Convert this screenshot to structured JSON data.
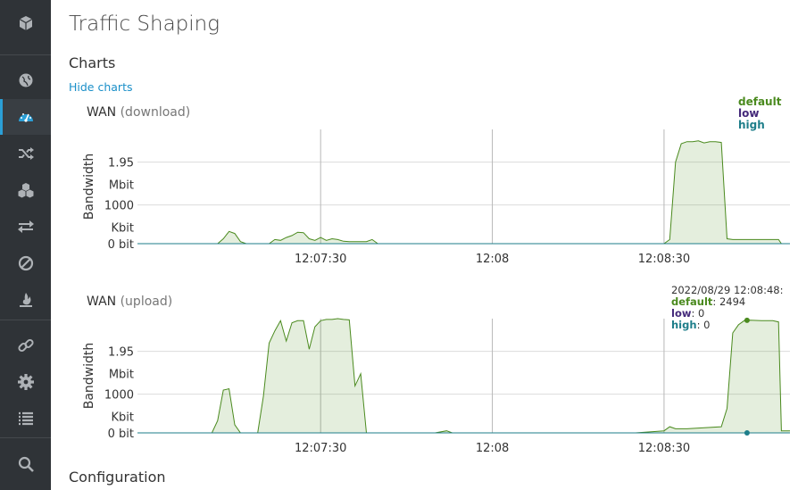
{
  "page": {
    "title": "Traffic Shaping"
  },
  "sections": {
    "charts": "Charts",
    "hide_charts": "Hide charts",
    "configuration": "Configuration"
  },
  "sidebar": {
    "items": [
      {
        "icon": "cube-icon"
      },
      {
        "icon": "globe-icon"
      },
      {
        "icon": "dashboard-icon",
        "active": true
      },
      {
        "icon": "shuffle-icon"
      },
      {
        "icon": "cubes-icon"
      },
      {
        "icon": "exchange-icon"
      },
      {
        "icon": "ban-icon"
      },
      {
        "icon": "fire-icon"
      },
      {
        "icon": "link-icon"
      },
      {
        "icon": "gear-icon"
      },
      {
        "icon": "list-icon"
      },
      {
        "icon": "search-icon"
      }
    ]
  },
  "colors": {
    "default": "#4a8a1e",
    "low": "#44297a",
    "high": "#1e7e8a",
    "link": "#1a8fc8"
  },
  "legend": {
    "default": "default",
    "low": "low",
    "high": "high"
  },
  "tooltip": {
    "time": "2022/08/29 12:08:48:",
    "default_label": "default",
    "default_value": ": 2494",
    "low_label": "low",
    "low_value": ": 0",
    "high_label": "high",
    "high_value": ": 0"
  },
  "chart_data": [
    {
      "type": "area",
      "title": "WAN",
      "subtitle": "(download)",
      "ylabel": "Bandwidth",
      "yticks": [
        {
          "label": "1.95",
          "value": 2.0
        },
        {
          "label": "Mbit",
          "value": 1.45
        },
        {
          "label": "1000",
          "value": 0.95
        },
        {
          "label": "Kbit",
          "value": 0.4
        },
        {
          "label": "0 bit",
          "value": 0
        }
      ],
      "ylim": [
        0,
        2.8
      ],
      "xlim": [
        -62,
        52
      ],
      "xticks": [
        {
          "label": "12:07:30",
          "t": -30
        },
        {
          "label": "12:08",
          "t": 0
        },
        {
          "label": "12:08:30",
          "t": 30
        }
      ],
      "series": [
        {
          "name": "default",
          "points": [
            [
              -62,
              0
            ],
            [
              -48,
              0
            ],
            [
              -47,
              0.12
            ],
            [
              -46,
              0.3
            ],
            [
              -45,
              0.25
            ],
            [
              -44,
              0.05
            ],
            [
              -43,
              0
            ],
            [
              -39,
              0
            ],
            [
              -38,
              0.1
            ],
            [
              -37,
              0.08
            ],
            [
              -36,
              0.15
            ],
            [
              -35,
              0.2
            ],
            [
              -34,
              0.28
            ],
            [
              -33,
              0.27
            ],
            [
              -32,
              0.12
            ],
            [
              -31,
              0.08
            ],
            [
              -30,
              0.15
            ],
            [
              -29,
              0.08
            ],
            [
              -28,
              0.12
            ],
            [
              -27,
              0.1
            ],
            [
              -26,
              0.06
            ],
            [
              -25,
              0.05
            ],
            [
              -24,
              0.05
            ],
            [
              -23,
              0.05
            ],
            [
              -22,
              0.05
            ],
            [
              -21,
              0.1
            ],
            [
              -20,
              0
            ],
            [
              30,
              0
            ],
            [
              31,
              0.1
            ],
            [
              32,
              2.0
            ],
            [
              33,
              2.45
            ],
            [
              34,
              2.5
            ],
            [
              35,
              2.5
            ],
            [
              36,
              2.52
            ],
            [
              37,
              2.47
            ],
            [
              38,
              2.5
            ],
            [
              39,
              2.5
            ],
            [
              40,
              2.48
            ],
            [
              41,
              0.12
            ],
            [
              42,
              0.1
            ],
            [
              45,
              0.1
            ],
            [
              48,
              0.1
            ],
            [
              50,
              0.1
            ],
            [
              50.5,
              0
            ],
            [
              52,
              0
            ]
          ]
        },
        {
          "name": "low",
          "points": [
            [
              -62,
              0
            ],
            [
              52,
              0
            ]
          ]
        },
        {
          "name": "high",
          "points": [
            [
              -62,
              0
            ],
            [
              52,
              0
            ]
          ]
        }
      ]
    },
    {
      "type": "area",
      "title": "WAN",
      "subtitle": "(upload)",
      "ylabel": "Bandwidth",
      "yticks": [
        {
          "label": "1.95",
          "value": 2.0
        },
        {
          "label": "Mbit",
          "value": 1.45
        },
        {
          "label": "1000",
          "value": 0.95
        },
        {
          "label": "Kbit",
          "value": 0.4
        },
        {
          "label": "0 bit",
          "value": 0
        }
      ],
      "ylim": [
        0,
        2.8
      ],
      "xlim": [
        -62,
        52
      ],
      "xticks": [
        {
          "label": "12:07:30",
          "t": -30
        },
        {
          "label": "12:08",
          "t": 0
        },
        {
          "label": "12:08:30",
          "t": 30
        }
      ],
      "series": [
        {
          "name": "default",
          "points": [
            [
              -62,
              0
            ],
            [
              -49,
              0
            ],
            [
              -48,
              0.3
            ],
            [
              -47,
              1.05
            ],
            [
              -46,
              1.08
            ],
            [
              -45,
              0.2
            ],
            [
              -44,
              0
            ],
            [
              -41,
              0
            ],
            [
              -40,
              0.9
            ],
            [
              -39,
              2.2
            ],
            [
              -38,
              2.5
            ],
            [
              -37,
              2.75
            ],
            [
              -36,
              2.25
            ],
            [
              -35,
              2.7
            ],
            [
              -34,
              2.75
            ],
            [
              -33,
              2.75
            ],
            [
              -32,
              2.05
            ],
            [
              -31,
              2.6
            ],
            [
              -30,
              2.75
            ],
            [
              -29,
              2.78
            ],
            [
              -28,
              2.78
            ],
            [
              -27,
              2.8
            ],
            [
              -26,
              2.78
            ],
            [
              -25,
              2.77
            ],
            [
              -24,
              1.15
            ],
            [
              -23,
              1.45
            ],
            [
              -22,
              0
            ],
            [
              -20,
              0
            ],
            [
              -10,
              0
            ],
            [
              -8,
              0.05
            ],
            [
              -7,
              0
            ],
            [
              25,
              0
            ],
            [
              30,
              0.05
            ],
            [
              31,
              0.15
            ],
            [
              32,
              0.1
            ],
            [
              34,
              0.1
            ],
            [
              40,
              0.15
            ],
            [
              41,
              0.6
            ],
            [
              42,
              2.45
            ],
            [
              43,
              2.65
            ],
            [
              44,
              2.75
            ],
            [
              45,
              2.76
            ],
            [
              47,
              2.75
            ],
            [
              49,
              2.75
            ],
            [
              50,
              2.72
            ],
            [
              50.5,
              0.05
            ],
            [
              52,
              0.05
            ]
          ]
        },
        {
          "name": "low",
          "points": [
            [
              -62,
              0
            ],
            [
              52,
              0
            ]
          ]
        },
        {
          "name": "high",
          "points": [
            [
              -62,
              0
            ],
            [
              52,
              0
            ]
          ]
        }
      ],
      "hover": {
        "t": 44.5,
        "default": 2494,
        "low": 0,
        "high": 0
      }
    }
  ]
}
